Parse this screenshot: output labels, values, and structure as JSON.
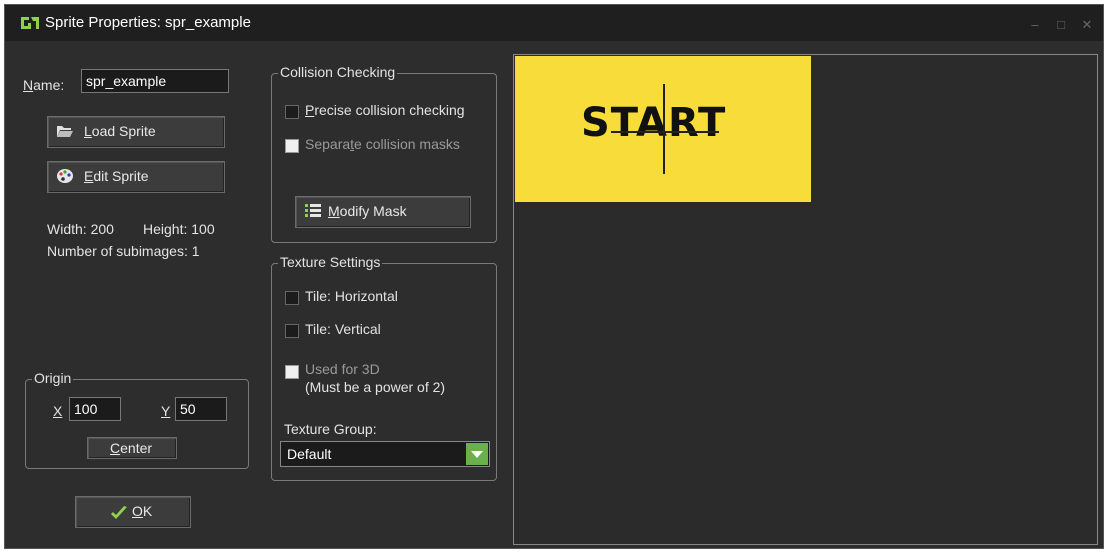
{
  "window": {
    "title": "Sprite Properties: spr_example",
    "controls": [
      "minimize",
      "maximize",
      "close"
    ]
  },
  "name": {
    "label_prefix": "",
    "label_underline": "N",
    "label_rest": "ame:",
    "value": "spr_example"
  },
  "buttons": {
    "load_sprite": {
      "underline": "L",
      "rest": "oad Sprite"
    },
    "edit_sprite": {
      "underline": "E",
      "rest": "dit Sprite"
    },
    "modify_mask": {
      "underline": "M",
      "rest": "odify Mask"
    },
    "center": {
      "underline": "C",
      "rest": "enter"
    },
    "ok": {
      "underline": "O",
      "rest": "K"
    }
  },
  "info": {
    "width_text": "Width: 200",
    "height_text": "Height: 100",
    "subimages_text": "Number of subimages: 1"
  },
  "origin": {
    "group_title": "Origin",
    "x_label": "X",
    "x_value": "100",
    "y_label": "Y",
    "y_value": "50"
  },
  "collision": {
    "group_title": "Collision Checking",
    "precise": {
      "underline": "P",
      "rest": "recise collision checking",
      "checked": false
    },
    "separate": {
      "pre": "Separa",
      "underline": "t",
      "rest": "e collision masks",
      "checked": false,
      "enabled": false
    }
  },
  "texture": {
    "group_title": "Texture Settings",
    "tile_horizontal": "Tile: Horizontal",
    "tile_vertical": "Tile: Vertical",
    "used_3d": "Used for 3D",
    "used_3d_note": "(Must be a power of 2)",
    "group_label": "Texture Group:",
    "group_value": "Default"
  },
  "preview": {
    "sprite_text": "START",
    "background_color": "#f8dd3a"
  }
}
